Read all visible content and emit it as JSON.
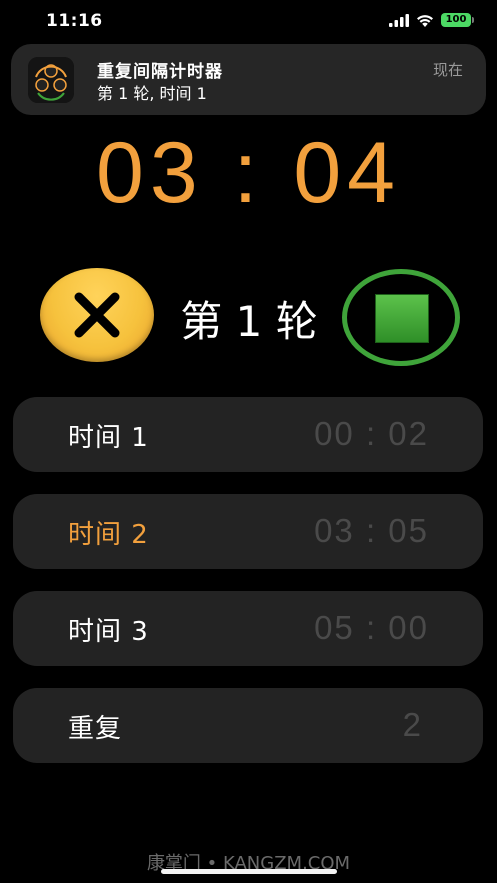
{
  "status_bar": {
    "time": "11:16",
    "battery": "100",
    "icons": [
      "signal-icon",
      "wifi-icon",
      "battery-icon"
    ]
  },
  "notification": {
    "title": "重复间隔计时器",
    "body": "第 1 轮, 时间 1",
    "time": "现在",
    "app_icon": "timer-app-icon"
  },
  "timer": {
    "display": "03 : 04"
  },
  "controls": {
    "round_label": "第 1 轮",
    "cancel_icon": "close-icon",
    "stop_icon": "stop-icon"
  },
  "rows": [
    {
      "label": "时间 1",
      "value": "00 : 02",
      "active": false
    },
    {
      "label": "时间 2",
      "value": "03 : 05",
      "active": true
    },
    {
      "label": "时间 3",
      "value": "05 : 00",
      "active": false
    },
    {
      "label": "重复",
      "value": "2",
      "active": false
    }
  ],
  "watermark": "康掌门 • KANGZM.COM",
  "colors": {
    "accent": "#f2a03d",
    "cancel_button": "#f6c23d",
    "stop_button": "#3fa43a",
    "row_background": "#232323",
    "muted_value": "#4a4a4a"
  }
}
